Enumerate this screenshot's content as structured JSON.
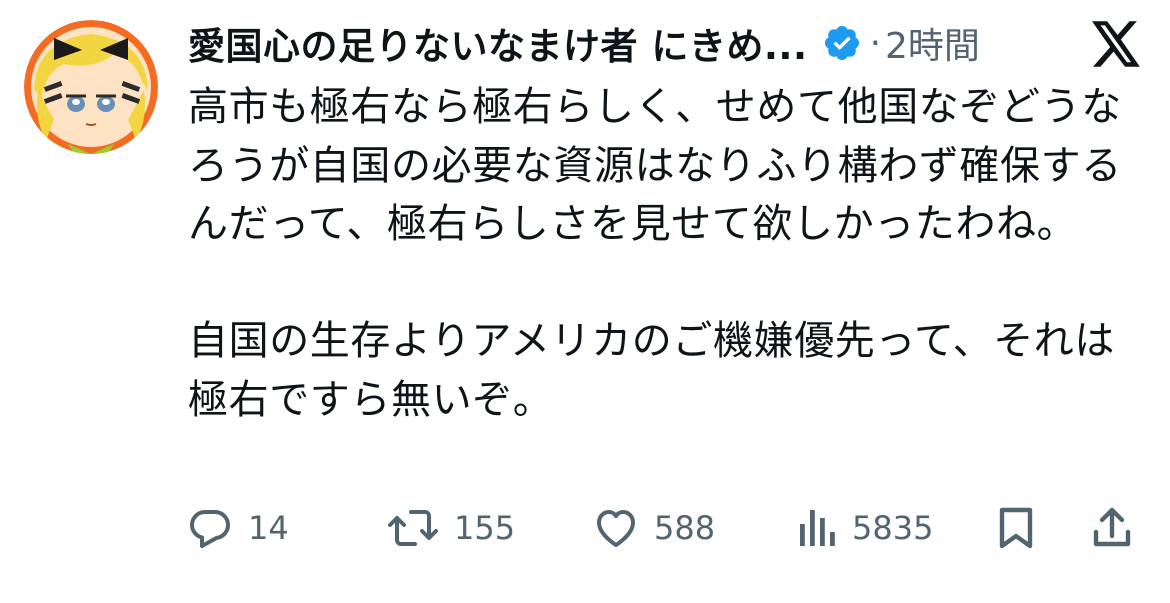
{
  "user": {
    "display_name": "愛国心の足りないなまけ者 にきめ...",
    "verified": true,
    "separator": "·",
    "time_ago": "2時間"
  },
  "tweet": {
    "text": "高市も極右なら極右らしく、せめて他国なぞどうなろうが自国の必要な資源はなりふり構わず確保するんだって、極右らしさを見せて欲しかったわね。\n\n自国の生存よりアメリカのご機嫌優先って、それは極右ですら無いぞ。"
  },
  "actions": {
    "replies": "14",
    "reposts": "155",
    "likes": "588",
    "views": "5835"
  },
  "icons": {
    "verified": "verified-badge-icon",
    "logo": "x-logo-icon",
    "reply": "reply-icon",
    "repost": "repost-icon",
    "like": "heart-icon",
    "views": "views-chart-icon",
    "bookmark": "bookmark-icon",
    "share": "share-icon"
  },
  "colors": {
    "text": "#0f1419",
    "secondary": "#536471",
    "verified_blue": "#1d9bf0",
    "avatar_ring": "#f36c21",
    "avatar_hair": "#f2d541"
  }
}
